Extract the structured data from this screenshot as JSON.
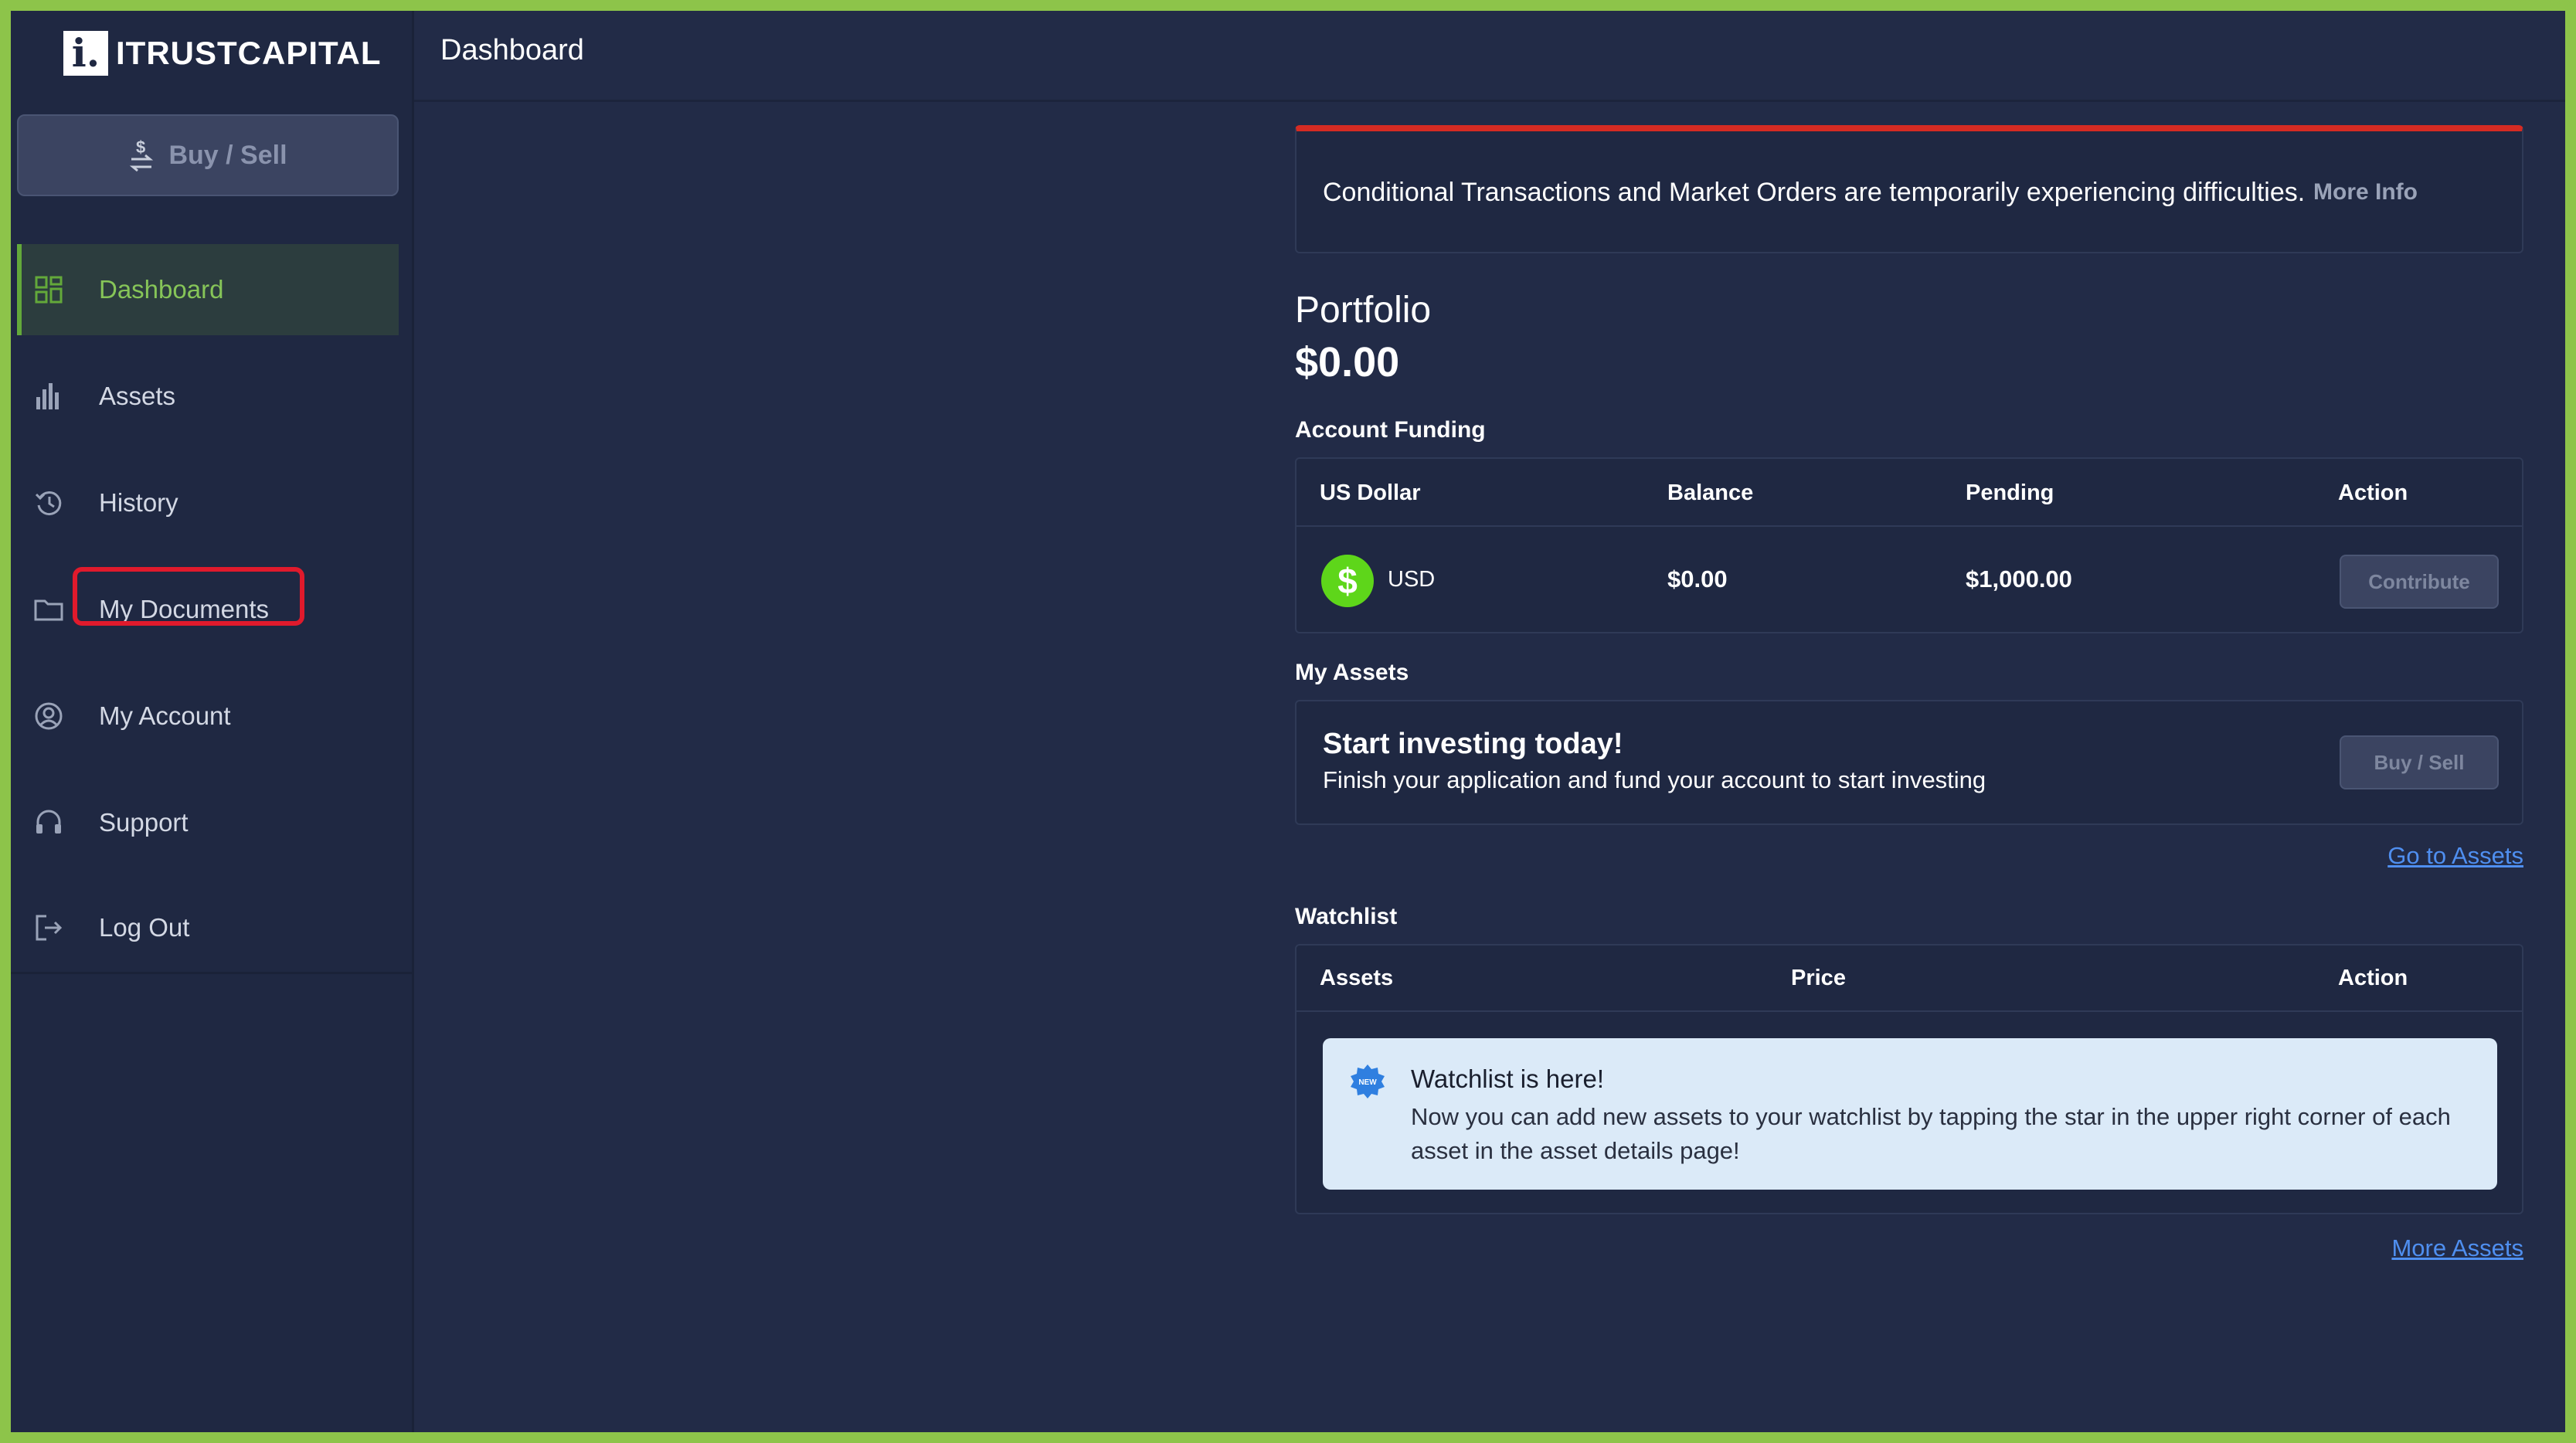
{
  "app": {
    "logo_mark": "i.",
    "logo_text": "ITRUSTCAPITAL"
  },
  "header": {
    "title": "Dashboard"
  },
  "sidebar": {
    "buy_sell_label": "Buy / Sell",
    "items": [
      {
        "label": "Dashboard",
        "icon": "grid-icon",
        "active": true
      },
      {
        "label": "Assets",
        "icon": "bar-chart-icon"
      },
      {
        "label": "History",
        "icon": "history-icon"
      },
      {
        "label": "My Documents",
        "icon": "folder-icon",
        "highlighted": true
      },
      {
        "label": "My Account",
        "icon": "user-circle-icon"
      },
      {
        "label": "Support",
        "icon": "headset-icon"
      },
      {
        "label": "Log Out",
        "icon": "logout-icon"
      }
    ]
  },
  "alert": {
    "message": "Conditional Transactions and Market Orders are temporarily experiencing difficulties.",
    "link": "More Info",
    "color": "#d52b23"
  },
  "portfolio": {
    "label": "Portfolio",
    "value": "$0.00"
  },
  "account_funding": {
    "label": "Account Funding",
    "columns": [
      "US Dollar",
      "Balance",
      "Pending",
      "Action"
    ],
    "row": {
      "icon": "dollar-coin-icon",
      "coin_symbol": "$",
      "currency": "USD",
      "balance": "$0.00",
      "pending": "$1,000.00",
      "action": "Contribute"
    }
  },
  "my_assets": {
    "label": "My Assets",
    "title": "Start investing today!",
    "subtitle": "Finish your application and fund your account to start investing",
    "button": "Buy / Sell",
    "link": "Go to Assets"
  },
  "watchlist": {
    "label": "Watchlist",
    "columns": [
      "Assets",
      "Price",
      "Action"
    ],
    "info": {
      "badge": "NEW",
      "title": "Watchlist is here!",
      "body": "Now you can add new assets to your watchlist by tapping the star in the upper right corner of each asset in the asset details page!"
    },
    "link": "More Assets"
  },
  "colors": {
    "accent_green": "#86c558",
    "link_blue": "#4f8ff0",
    "coin_green": "#5ed61a",
    "highlight_red": "#e01a2c"
  }
}
